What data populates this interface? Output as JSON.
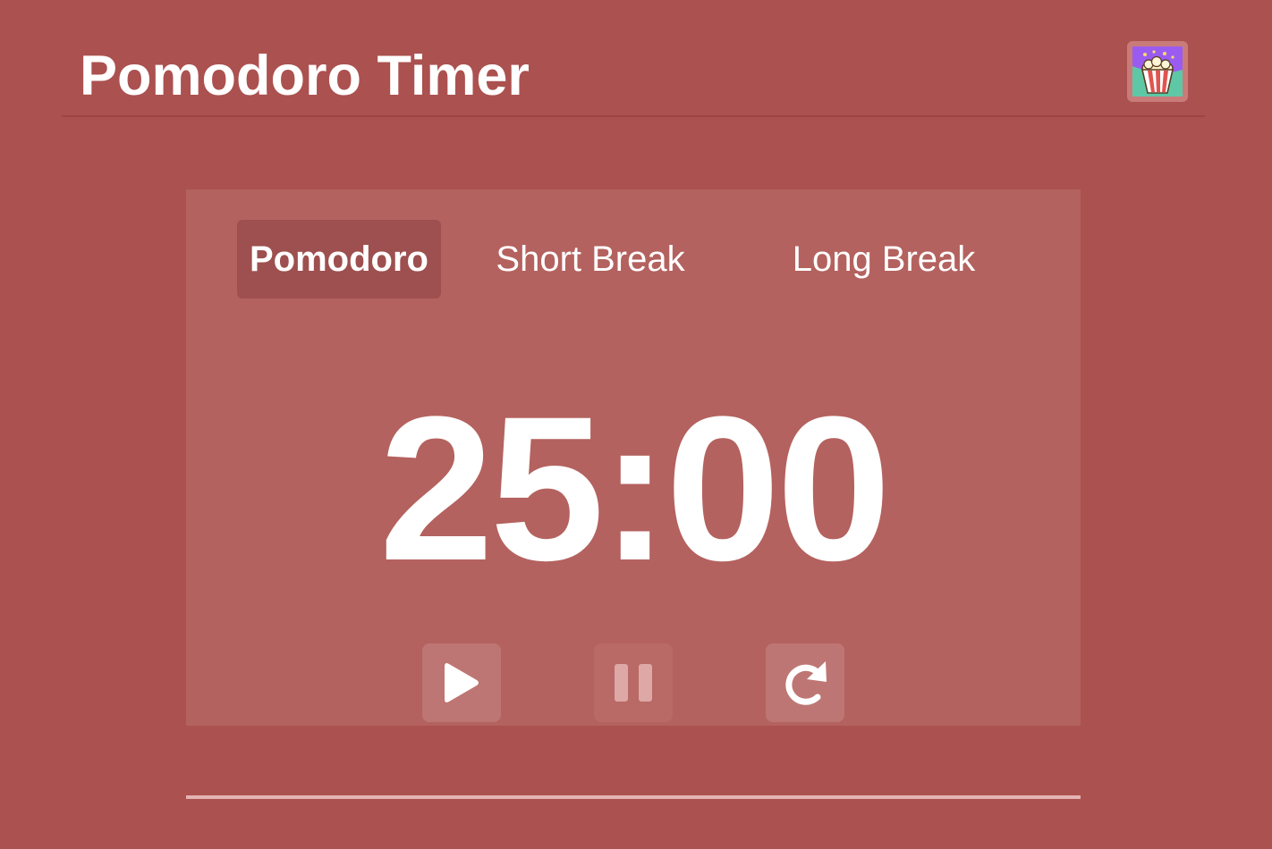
{
  "header": {
    "title": "Pomodoro Timer",
    "avatar_icon": "popcorn-icon"
  },
  "modes": [
    {
      "label": "Pomodoro",
      "active": true
    },
    {
      "label": "Short Break",
      "active": false
    },
    {
      "label": "Long Break",
      "active": false
    }
  ],
  "timer": {
    "display": "25:00"
  },
  "controls": {
    "play_icon": "play-icon",
    "pause_icon": "pause-icon",
    "reset_icon": "reset-icon"
  },
  "progress": {
    "fraction": 0
  },
  "colors": {
    "background": "#ab514f",
    "card": "#b4625f",
    "active_tab": "#9d504f"
  }
}
